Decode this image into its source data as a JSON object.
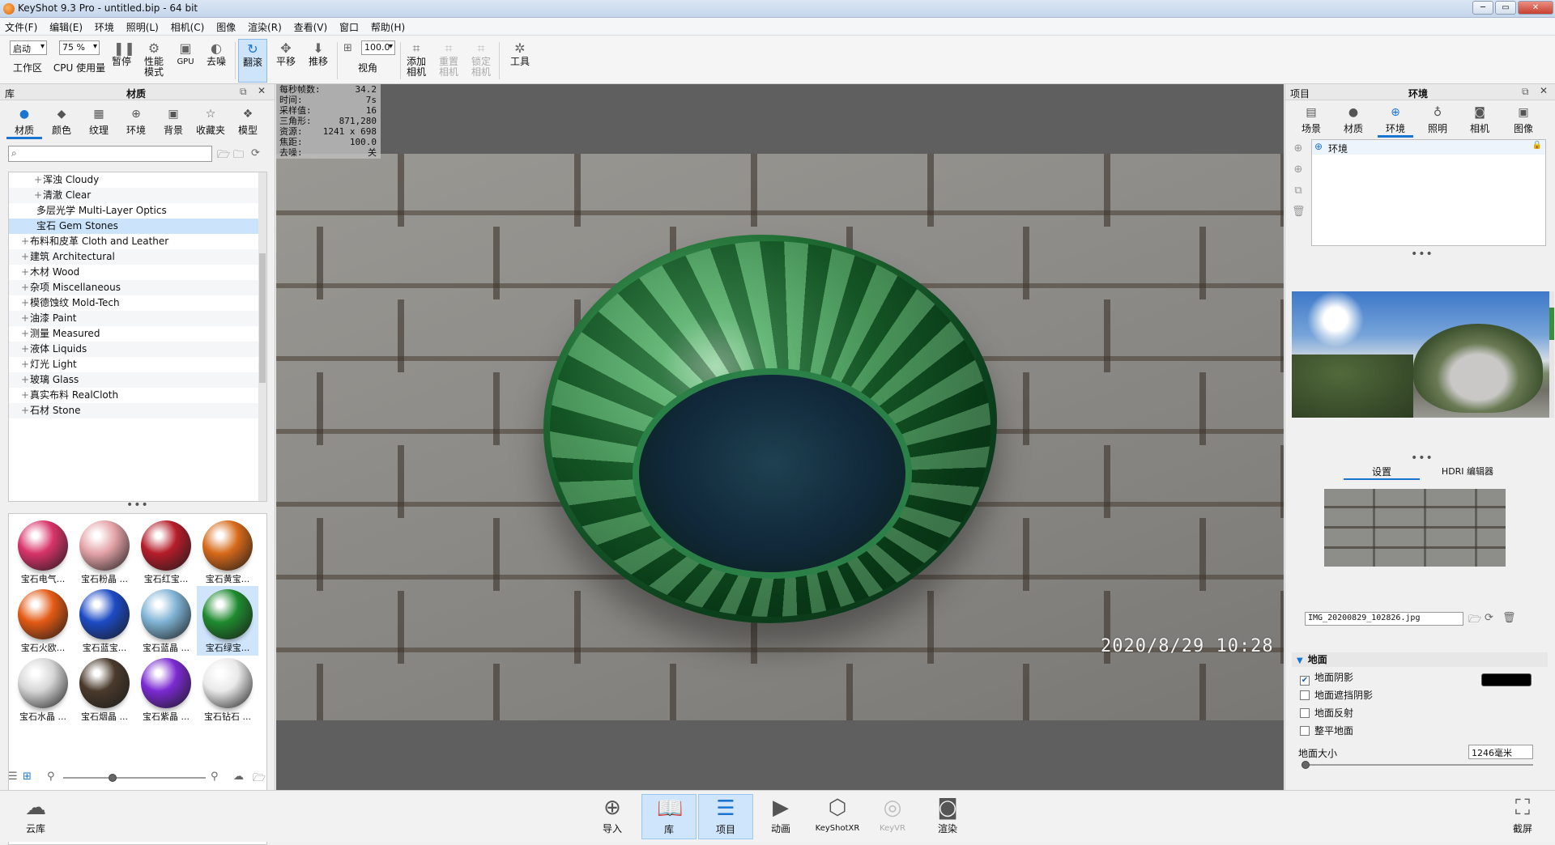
{
  "window": {
    "title": "KeyShot 9.3 Pro  - untitled.bip - 64 bit",
    "controls": [
      "─",
      "▭",
      "✕"
    ]
  },
  "menu": [
    "文件(F)",
    "编辑(E)",
    "环境",
    "照明(L)",
    "相机(C)",
    "图像",
    "渲染(R)",
    "查看(V)",
    "窗口",
    "帮助(H)"
  ],
  "toolbar": {
    "workspace_value": "启动",
    "workspace_label": "工作区",
    "cpu_value": "75 %",
    "cpu_label": "CPU 使用量",
    "pause": "暂停",
    "perf_label": "性能\n模式",
    "gpu": "GPU",
    "denoise": "去噪",
    "tumble": "翻滚",
    "pan": "平移",
    "dolly": "推移",
    "fov_value": "100.0",
    "fov_label": "视角",
    "add_camera": "添加\n相机",
    "reset_camera": "重置\n相机",
    "lock_camera": "锁定\n相机",
    "tools": "工具"
  },
  "left_panel": {
    "header_left": "库",
    "header_title": "材质",
    "tabs": [
      "材质",
      "颜色",
      "纹理",
      "环境",
      "背景",
      "收藏夹",
      "模型"
    ],
    "tree": [
      {
        "label": "浑浊 Cloudy",
        "indent": 2,
        "pm": "+"
      },
      {
        "label": "清澈 Clear",
        "indent": 2,
        "pm": "+"
      },
      {
        "label": "多层光学 Multi-Layer Optics",
        "indent": 1,
        "pm": ""
      },
      {
        "label": "宝石 Gem Stones",
        "indent": 1,
        "pm": "",
        "selected": true
      },
      {
        "label": "布料和皮革 Cloth and Leather",
        "indent": 0,
        "pm": "+"
      },
      {
        "label": "建筑 Architectural",
        "indent": 0,
        "pm": "+"
      },
      {
        "label": "木材 Wood",
        "indent": 0,
        "pm": "+"
      },
      {
        "label": "杂项 Miscellaneous",
        "indent": 0,
        "pm": "+"
      },
      {
        "label": "模德蚀纹 Mold-Tech",
        "indent": 0,
        "pm": "+"
      },
      {
        "label": "油漆 Paint",
        "indent": 0,
        "pm": "+"
      },
      {
        "label": "测量 Measured",
        "indent": 0,
        "pm": "+"
      },
      {
        "label": "液体 Liquids",
        "indent": 0,
        "pm": "+"
      },
      {
        "label": "灯光 Light",
        "indent": 0,
        "pm": "+"
      },
      {
        "label": "玻璃 Glass",
        "indent": 0,
        "pm": "+"
      },
      {
        "label": "真实布料 RealCloth",
        "indent": 0,
        "pm": "+"
      },
      {
        "label": "石材 Stone",
        "indent": 0,
        "pm": "+"
      }
    ],
    "materials": [
      {
        "name": "宝石电气...",
        "color": "#d8346a"
      },
      {
        "name": "宝石粉晶 ...",
        "color": "#e4a3a8"
      },
      {
        "name": "宝石红宝...",
        "color": "#b51d2a"
      },
      {
        "name": "宝石黄宝...",
        "color": "#d76a1a"
      },
      {
        "name": "宝石火欧...",
        "color": "#e35a14"
      },
      {
        "name": "宝石蓝宝...",
        "color": "#1d4bc4"
      },
      {
        "name": "宝石蓝晶 ...",
        "color": "#7fb3d4"
      },
      {
        "name": "宝石绿宝...",
        "color": "#1f8a2f",
        "selected": true
      },
      {
        "name": "宝石水晶 ...",
        "color": "#d6d6d6"
      },
      {
        "name": "宝石烟晶 ...",
        "color": "#4a3a2c"
      },
      {
        "name": "宝石紫晶 ...",
        "color": "#7b2ad1"
      },
      {
        "name": "宝石钻石 ...",
        "color": "#e9e9e9"
      }
    ]
  },
  "viewport": {
    "stats": [
      {
        "k": "每秒帧数:",
        "v": "34.2"
      },
      {
        "k": "时间:",
        "v": "7s"
      },
      {
        "k": "采样值:",
        "v": "16"
      },
      {
        "k": "三角形:",
        "v": "871,280"
      },
      {
        "k": "资源:",
        "v": "1241 x 698"
      },
      {
        "k": "焦距:",
        "v": "100.0"
      },
      {
        "k": "去噪:",
        "v": "关"
      }
    ],
    "timestamp": "2020/8/29  10:28"
  },
  "right_panel": {
    "header_left": "项目",
    "header_title": "环境",
    "tabs": [
      "场景",
      "材质",
      "环境",
      "照明",
      "相机",
      "图像"
    ],
    "env_item": "环境",
    "subtabs": [
      "设置",
      "HDRI 编辑器"
    ],
    "file": "IMG_20200829_102826.jpg",
    "ground_section": "地面",
    "checkboxes": [
      {
        "label": "地面阴影",
        "checked": true
      },
      {
        "label": "地面遮挡阴影",
        "checked": false
      },
      {
        "label": "地面反射",
        "checked": false
      },
      {
        "label": "整平地面",
        "checked": false
      }
    ],
    "ground_size_label": "地面大小",
    "ground_size_value": "1246毫米"
  },
  "bottom": {
    "cloud": "云库",
    "buttons": [
      "导入",
      "库",
      "项目",
      "动画",
      "KeyShotXR",
      "KeyVR",
      "渲染"
    ],
    "screenshot": "截屏"
  }
}
